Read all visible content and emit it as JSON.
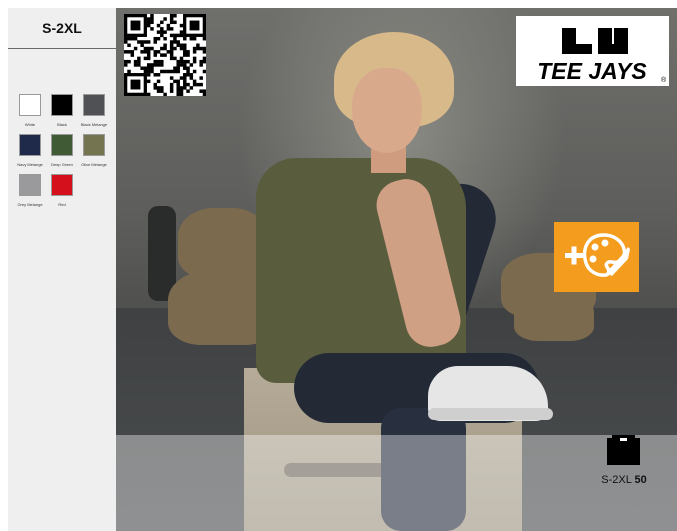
{
  "sizes": "S-2XL",
  "colors": [
    {
      "name": "White",
      "hex": "#ffffff"
    },
    {
      "name": "Black",
      "hex": "#000000"
    },
    {
      "name": "Black Melange",
      "hex": "#4f5154"
    },
    {
      "name": "Navy Melange",
      "hex": "#1f2a4a"
    },
    {
      "name": "Deep Green",
      "hex": "#3f5a35"
    },
    {
      "name": "Olive Melange",
      "hex": "#747550"
    },
    {
      "name": "Grey Melange",
      "hex": "#9a9a9c"
    },
    {
      "name": "Red",
      "hex": "#d3101c"
    }
  ],
  "brand": {
    "name": "TEE JAYS",
    "registered": "®"
  },
  "icons": {
    "qr": "qr-code-icon",
    "customize": "customize-palette-icon",
    "pack": "carton-box-icon"
  },
  "accent_orange": "#f49c1d",
  "pack_info": {
    "size_range": "S-2XL",
    "quantity": "50"
  }
}
